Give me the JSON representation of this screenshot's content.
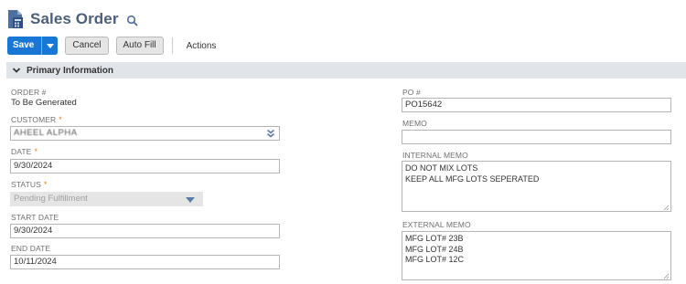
{
  "header": {
    "title": "Sales Order"
  },
  "toolbar": {
    "save_label": "Save",
    "cancel_label": "Cancel",
    "autofill_label": "Auto Fill",
    "actions_label": "Actions"
  },
  "section": {
    "title": "Primary Information"
  },
  "fields": {
    "order_num": {
      "label": "ORDER #",
      "value": "To Be Generated"
    },
    "customer": {
      "label": "CUSTOMER",
      "required": "*",
      "value": "AHEEL ALPHA"
    },
    "date": {
      "label": "DATE",
      "required": "*",
      "value": "9/30/2024"
    },
    "status": {
      "label": "STATUS",
      "required": "*",
      "value": "Pending Fulfillment"
    },
    "start_date": {
      "label": "START DATE",
      "value": "9/30/2024"
    },
    "end_date": {
      "label": "END DATE",
      "value": "10/11/2024"
    },
    "po_num": {
      "label": "PO #",
      "value": "PO15642"
    },
    "memo": {
      "label": "MEMO",
      "value": ""
    },
    "internal_memo": {
      "label": "INTERNAL MEMO",
      "lines": [
        "DO NOT MIX LOTS",
        "KEEP ALL MFG LOTS SEPERATED"
      ]
    },
    "external_memo": {
      "label": "EXTERNAL MEMO",
      "lines": [
        "MFG LOT# 23B",
        "MFG LOT# 24B",
        "MFG LOT# 12C"
      ]
    }
  },
  "icons": {
    "document": "sales-order-document-icon",
    "search": "search-icon",
    "collapse": "chevron-down-icon",
    "dropdown": "caret-down-icon",
    "customer_select": "double-chevron-down-icon"
  },
  "colors": {
    "primary": "#1877d4",
    "title": "#4d5f79",
    "section_bg": "#e1e4e9",
    "required": "#e87f18"
  }
}
